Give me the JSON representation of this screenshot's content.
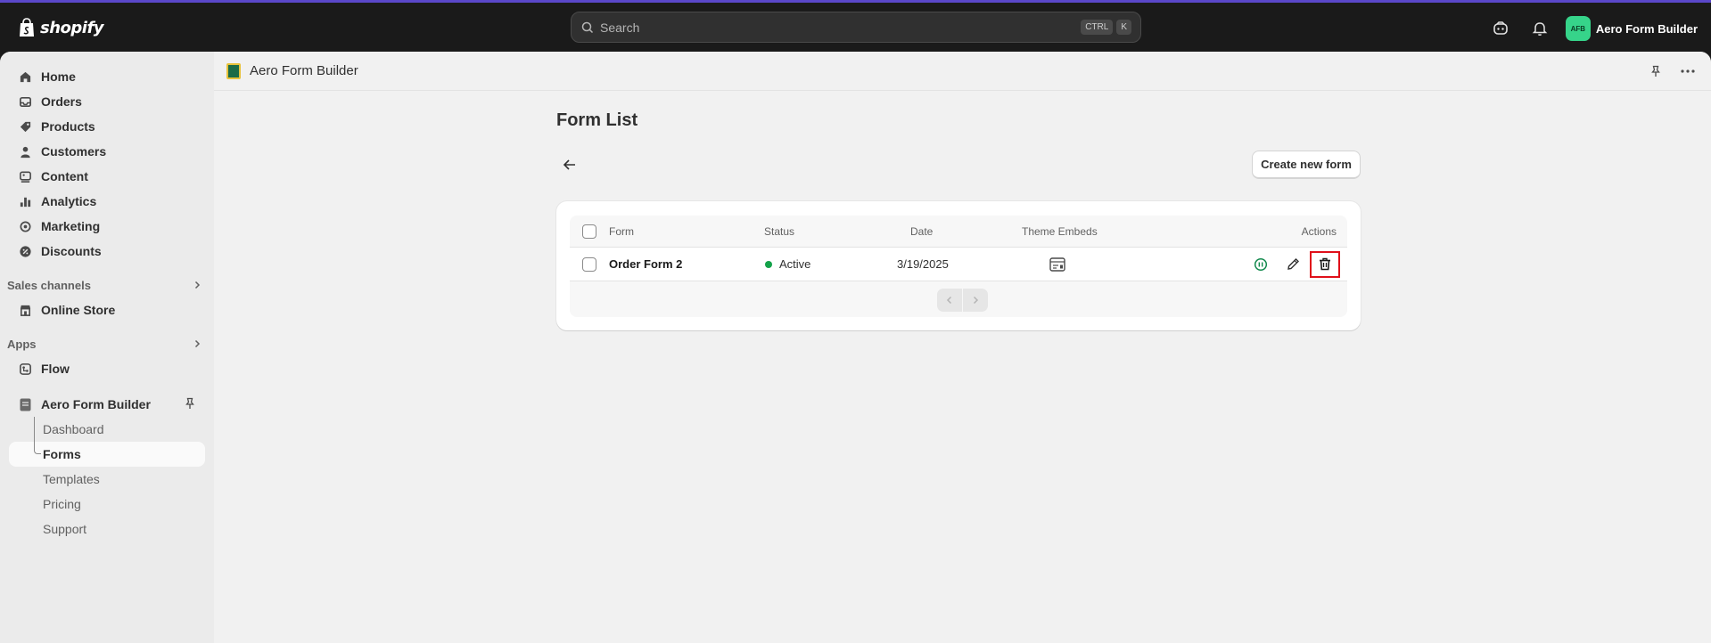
{
  "topbar": {
    "logo_text": "shopify",
    "search_placeholder": "Search",
    "shortcut_keys": [
      "CTRL",
      "K"
    ],
    "avatar_initials": "AFB",
    "store_name": "Aero Form Builder"
  },
  "sidebar": {
    "main_items": [
      {
        "label": "Home",
        "icon": "home-icon"
      },
      {
        "label": "Orders",
        "icon": "inbox-icon"
      },
      {
        "label": "Products",
        "icon": "tag-icon"
      },
      {
        "label": "Customers",
        "icon": "person-icon"
      },
      {
        "label": "Content",
        "icon": "content-icon"
      },
      {
        "label": "Analytics",
        "icon": "chart-icon"
      },
      {
        "label": "Marketing",
        "icon": "target-icon"
      },
      {
        "label": "Discounts",
        "icon": "discount-icon"
      }
    ],
    "sales_channels_label": "Sales channels",
    "online_store_label": "Online Store",
    "apps_label": "Apps",
    "flow_label": "Flow",
    "app_name": "Aero Form Builder",
    "app_subitems": [
      "Dashboard",
      "Forms",
      "Templates",
      "Pricing",
      "Support"
    ],
    "active_subitem": "Forms"
  },
  "app_header": {
    "title": "Aero Form Builder"
  },
  "page": {
    "title": "Form List",
    "create_button": "Create new form"
  },
  "table": {
    "columns": [
      "Form",
      "Status",
      "Date",
      "Theme Embeds",
      "Actions"
    ],
    "rows": [
      {
        "form": "Order Form 2",
        "status": "Active",
        "date": "3/19/2025"
      }
    ]
  },
  "colors": {
    "accent_border": "#5a47c9",
    "status_active": "#14a24a",
    "highlight": "#e0101a",
    "avatar_bg": "#36d48a"
  }
}
